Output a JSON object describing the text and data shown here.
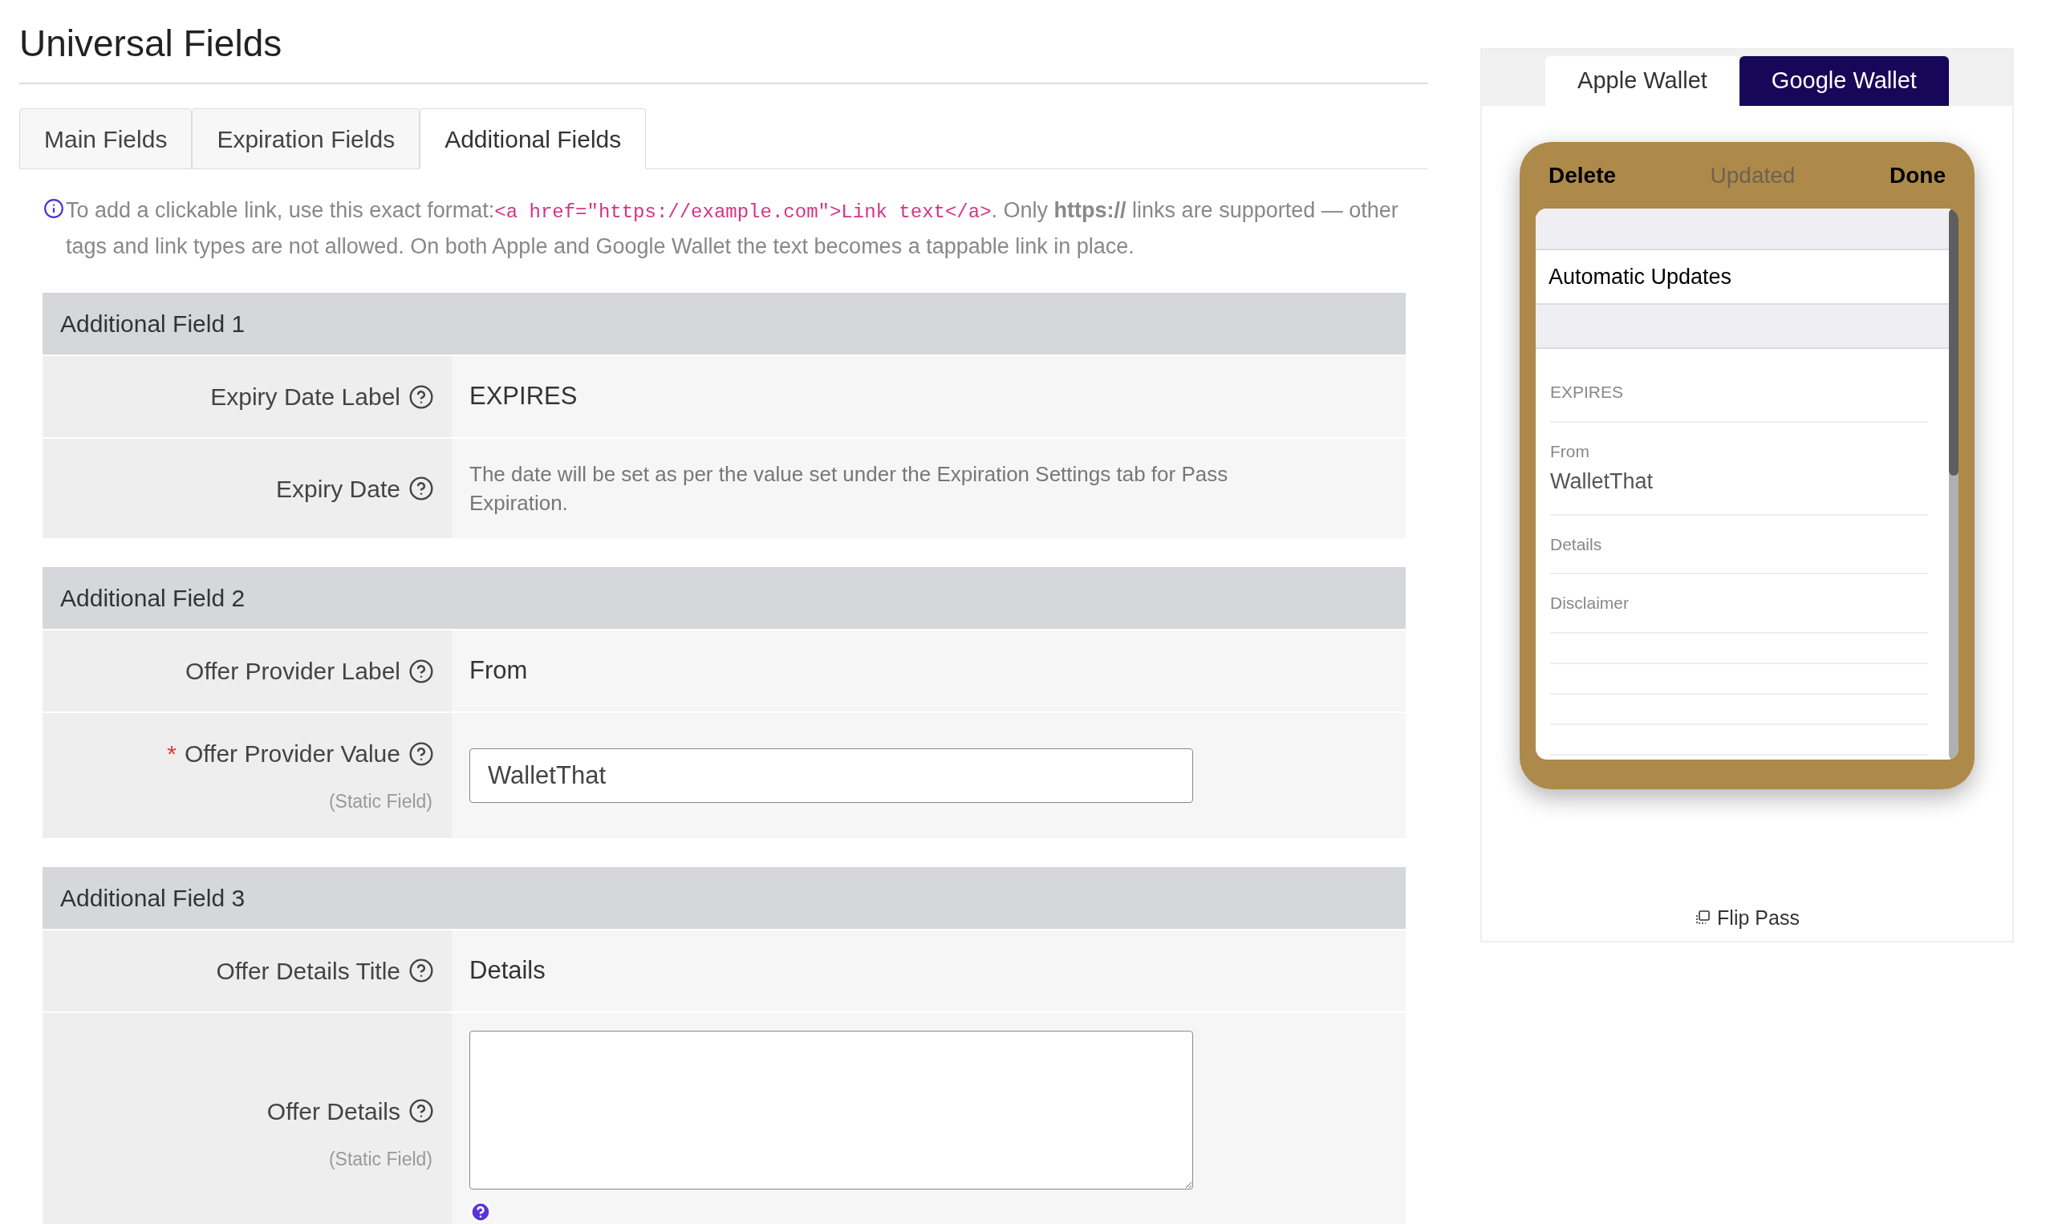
{
  "page_title": "Universal Fields",
  "tabs": [
    {
      "label": "Main Fields",
      "selected": false
    },
    {
      "label": "Expiration Fields",
      "selected": false
    },
    {
      "label": "Additional Fields",
      "selected": true
    }
  ],
  "info": [
    {
      "kind": "text",
      "text": "To add a clickable link, use this exact format:"
    },
    {
      "kind": "code",
      "text": "<a href=\"https://example.com\">Link text</a>"
    },
    {
      "kind": "text",
      "text": ". Only **https://** links are supported — other tags and link types are not allowed. On both Apple and Google Wallet the text becomes a tappable link in place."
    }
  ],
  "sections": [
    {
      "title": "Additional Field 1",
      "rows": [
        {
          "label": "Expiry Date Label",
          "kind": "text",
          "value": "EXPIRES"
        },
        {
          "label": "Expiry Date",
          "kind": "note",
          "value": "The date will be set as per the value set under the Expiration Settings tab for Pass Expiration."
        }
      ]
    },
    {
      "title": "Additional Field 2",
      "rows": [
        {
          "label": "Offer Provider Label",
          "kind": "text",
          "value": "From"
        },
        {
          "label": "Offer Provider Value",
          "marker": "*",
          "sub": "(Static Field)",
          "kind": "input",
          "value": "WalletThat"
        }
      ]
    },
    {
      "title": "Additional Field 3",
      "rows": [
        {
          "label": "Offer Details Title",
          "kind": "text",
          "value": "Details"
        },
        {
          "label": "Offer Details",
          "sub": "(Static Field)",
          "kind": "textarea"
        }
      ]
    }
  ],
  "wallet_tabs": [
    {
      "label": "Apple Wallet",
      "selected": false
    },
    {
      "label": "Google Wallet",
      "selected": true
    }
  ],
  "preview": {
    "left": "Delete",
    "center": "Updated",
    "right": "Done",
    "heading": "Automatic Updates",
    "fields": [
      {
        "label": "EXPIRES"
      },
      {
        "label": "From",
        "value": "WalletThat"
      },
      {
        "label": "Details"
      },
      {
        "label": "Disclaimer"
      }
    ]
  },
  "flip": "Flip Pass"
}
